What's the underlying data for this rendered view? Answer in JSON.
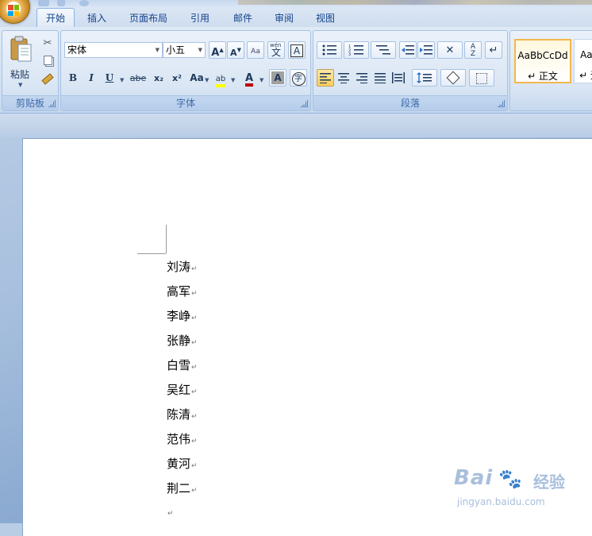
{
  "tabs": [
    "开始",
    "插入",
    "页面布局",
    "引用",
    "邮件",
    "审阅",
    "视图"
  ],
  "active_tab": "开始",
  "clipboard": {
    "paste_label": "粘贴",
    "group_label": "剪贴板"
  },
  "font": {
    "font_name": "宋体",
    "font_size": "小五",
    "group_label": "字体",
    "bold_label": "B",
    "italic_label": "I",
    "underline_label": "U",
    "strike_label": "abe",
    "sub_label": "x₂",
    "sup_label": "x²",
    "case_label": "Aa",
    "grow_label": "A",
    "shrink_label": "A",
    "highlight_label": "ab",
    "color_label": "A",
    "shade_label": "A",
    "phonetic_label": "wén",
    "phonetic_char": "文",
    "border_char": "A",
    "enclose_char": "字"
  },
  "paragraph": {
    "group_label": "段落"
  },
  "styles": [
    {
      "sample": "AaBbCcDd",
      "name": "↵ 正文"
    },
    {
      "sample": "AaB",
      "name": "↵ 无"
    }
  ],
  "document_lines": [
    "刘涛",
    "高军",
    "李峥",
    "张静",
    "白雪",
    "吴红",
    "陈清",
    "范伟",
    "黄河",
    "荆二",
    ""
  ],
  "paragraph_mark": "↵",
  "watermark": {
    "brand": "Bai",
    "brand_cn": "经验",
    "url": "jingyan.baidu.com"
  },
  "colors": {
    "accent": "#15428b",
    "ribbon_bg": "#dfe9f5",
    "selected_btn": "#ffcd5a"
  }
}
